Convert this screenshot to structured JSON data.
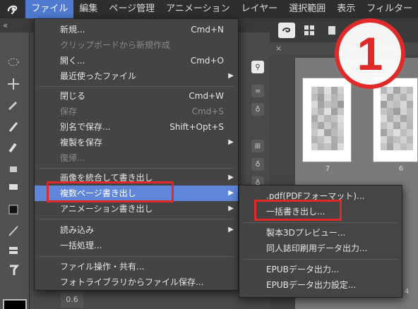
{
  "menubar": {
    "items": [
      {
        "label": "ファイル"
      },
      {
        "label": "編集"
      },
      {
        "label": "ページ管理"
      },
      {
        "label": "アニメーション"
      },
      {
        "label": "レイヤー"
      },
      {
        "label": "選択範囲"
      },
      {
        "label": "表示"
      },
      {
        "label": "フィルター"
      }
    ]
  },
  "file_menu": {
    "items": [
      {
        "label": "新規...",
        "shortcut": "Cmd+N",
        "enabled": true,
        "submenu": false
      },
      {
        "label": "クリップボードから新規作成",
        "shortcut": "",
        "enabled": false,
        "submenu": false
      },
      {
        "label": "開く...",
        "shortcut": "Cmd+O",
        "enabled": true,
        "submenu": false
      },
      {
        "label": "最近使ったファイル",
        "shortcut": "",
        "enabled": true,
        "submenu": true
      },
      {
        "label": "閉じる",
        "shortcut": "Cmd+W",
        "enabled": true,
        "submenu": false
      },
      {
        "label": "保存",
        "shortcut": "Cmd+S",
        "enabled": false,
        "submenu": false
      },
      {
        "label": "別名で保存...",
        "shortcut": "Shift+Opt+S",
        "enabled": true,
        "submenu": false
      },
      {
        "label": "複製を保存",
        "shortcut": "",
        "enabled": true,
        "submenu": true
      },
      {
        "label": "復帰...",
        "shortcut": "",
        "enabled": false,
        "submenu": false
      },
      {
        "label": "画像を統合して書き出し",
        "shortcut": "",
        "enabled": true,
        "submenu": true
      },
      {
        "label": "複数ページ書き出し",
        "shortcut": "",
        "enabled": true,
        "submenu": true
      },
      {
        "label": "アニメーション書き出し",
        "shortcut": "",
        "enabled": true,
        "submenu": true
      },
      {
        "label": "読み込み",
        "shortcut": "",
        "enabled": true,
        "submenu": true
      },
      {
        "label": "一括処理...",
        "shortcut": "",
        "enabled": true,
        "submenu": false
      },
      {
        "label": "ファイル操作・共有...",
        "shortcut": "",
        "enabled": true,
        "submenu": false
      },
      {
        "label": "フォトライブラリからファイル保存...",
        "shortcut": "",
        "enabled": true,
        "submenu": false
      }
    ]
  },
  "export_submenu": {
    "items": [
      {
        "label": ".pdf(PDFフォーマット)..."
      },
      {
        "label": "一括書き出し..."
      },
      {
        "label": "製本3Dプレビュー..."
      },
      {
        "label": "同人誌印刷用データ出力..."
      },
      {
        "label": "EPUBデータ出力..."
      },
      {
        "label": "EPUBデータ出力設定..."
      }
    ]
  },
  "callout": {
    "number": "1"
  },
  "pages": {
    "left_number": "7",
    "right_number": "6",
    "partial_number": "4"
  },
  "palette": {
    "value": "0.6"
  },
  "colors": {
    "highlight": "#5f86d8",
    "annotation_red": "#e02a2a"
  }
}
